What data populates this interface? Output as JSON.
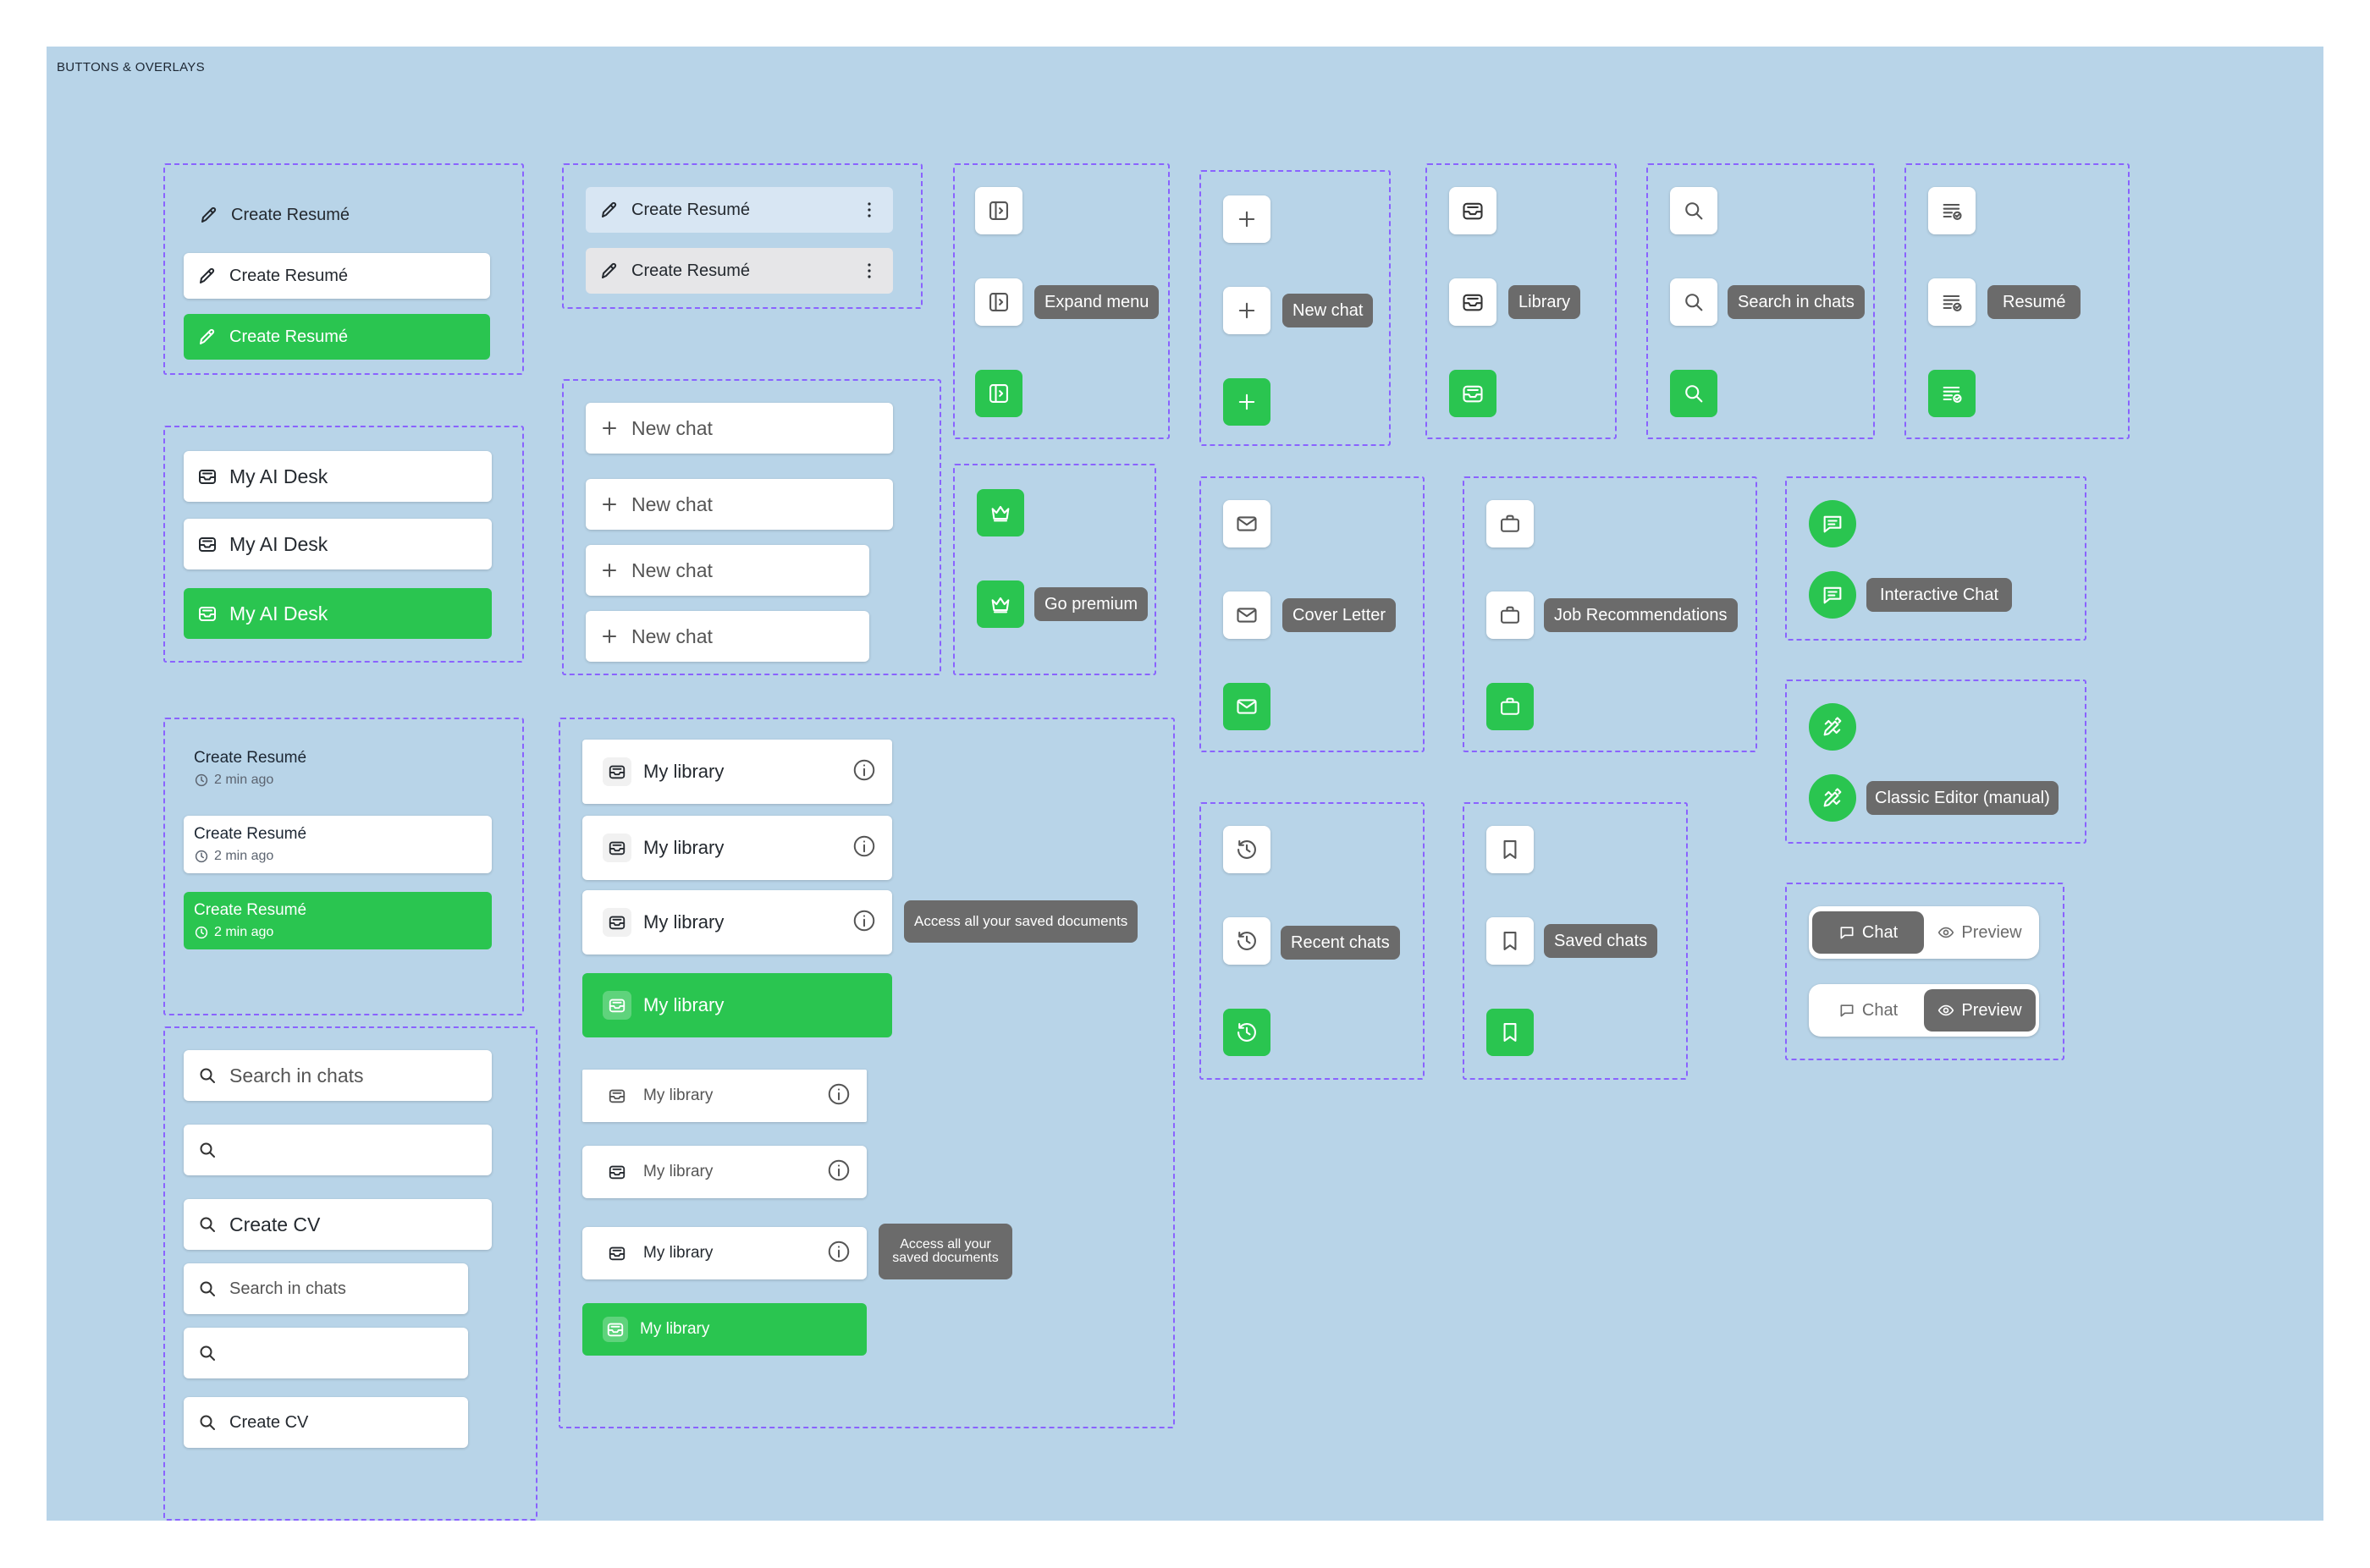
{
  "canvas": {
    "title": "BUTTONS & OVERLAYS"
  },
  "colors": {
    "canvas": "#b8d4e8",
    "accent_green": "#2ac550",
    "tooltip_gray": "#6b6b6b",
    "frame_dashed": "#8a63ff"
  },
  "create_resume": {
    "label": "Create Resumé",
    "icon": "pencil-icon"
  },
  "create_resume_more": {
    "label": "Create Resumé",
    "icon": "pencil-icon",
    "menu_icon": "kebab-icon"
  },
  "my_ai_desk": {
    "label": "My AI Desk",
    "icon": "inbox-icon"
  },
  "new_chat_list": {
    "label": "New chat",
    "icon": "plus-icon"
  },
  "recent_item": {
    "title": "Create Resumé",
    "time": "2 min ago"
  },
  "my_library": {
    "label": "My library",
    "tooltip": "Access all your saved documents"
  },
  "search": {
    "items": [
      "Search in chats",
      "",
      "Create CV"
    ]
  },
  "icon_buttons": {
    "expand_menu": "Expand menu",
    "new_chat": "New chat",
    "library": "Library",
    "search_in_chats": "Search in chats",
    "resume": "Resumé",
    "go_premium": "Go premium",
    "cover_letter": "Cover Letter",
    "job_recommendations": "Job Recommendations",
    "interactive_chat": "Interactive Chat",
    "recent_chats": "Recent chats",
    "saved_chats": "Saved chats",
    "classic_editor": "Classic Editor (manual)"
  },
  "toggle": {
    "chat": "Chat",
    "preview": "Preview"
  }
}
